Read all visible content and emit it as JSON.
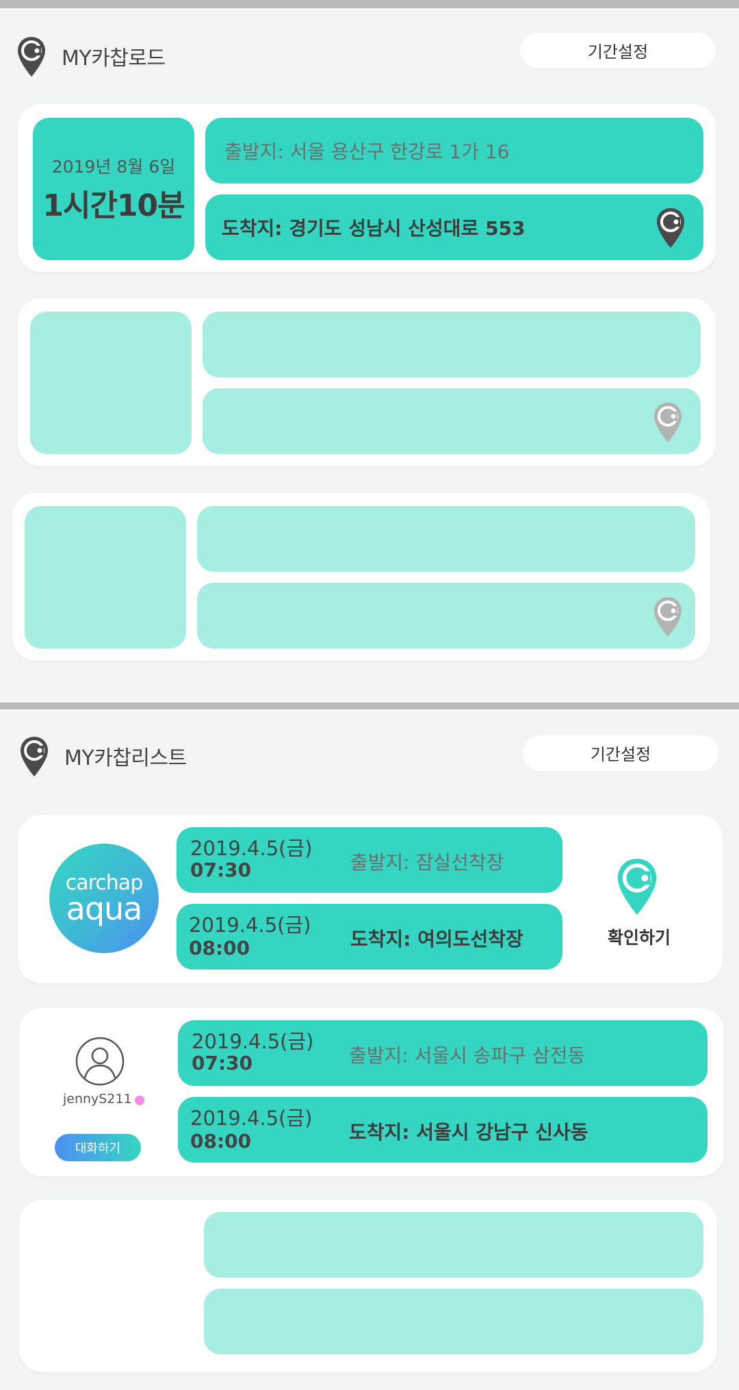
{
  "road": {
    "title": "MY카찹로드",
    "period_button": "기간설정",
    "trips": [
      {
        "date": "2019년 8월 6일",
        "duration": "1시간10분",
        "departure": "출발지: 서울 용산구 한강로 1가 16",
        "arrival": "도착지: 경기도 성남시 산성대로 553"
      }
    ],
    "empty_slots": 2
  },
  "list": {
    "title": "MY카찹리스트",
    "period_button": "기간설정",
    "items": [
      {
        "logo_top": "carchap",
        "logo_bottom": "aqua",
        "depart_date": "2019.4.5(금)",
        "depart_time": "07:30",
        "departure": "출발지: 잠실선착장",
        "arrive_date": "2019.4.5(금)",
        "arrive_time": "08:00",
        "arrival": "도착지: 여의도선착장",
        "action_label": "확인하기"
      },
      {
        "username": "jennyS211",
        "depart_date": "2019.4.5(금)",
        "depart_time": "07:30",
        "departure": "출발지: 서울시 송파구 삼전동",
        "arrive_date": "2019.4.5(금)",
        "arrive_time": "08:00",
        "arrival": "도착지: 서울시 강남구 신사동",
        "chat_button": "대화하기"
      }
    ]
  },
  "colors": {
    "teal": "#35d6c1",
    "teal_light": "#a6ede2",
    "online_dot": "#f58ae9",
    "divider": "#b9b9b9"
  },
  "icons": {
    "brand_pin": "carchap-pin-icon",
    "profile": "user-avatar-icon"
  }
}
